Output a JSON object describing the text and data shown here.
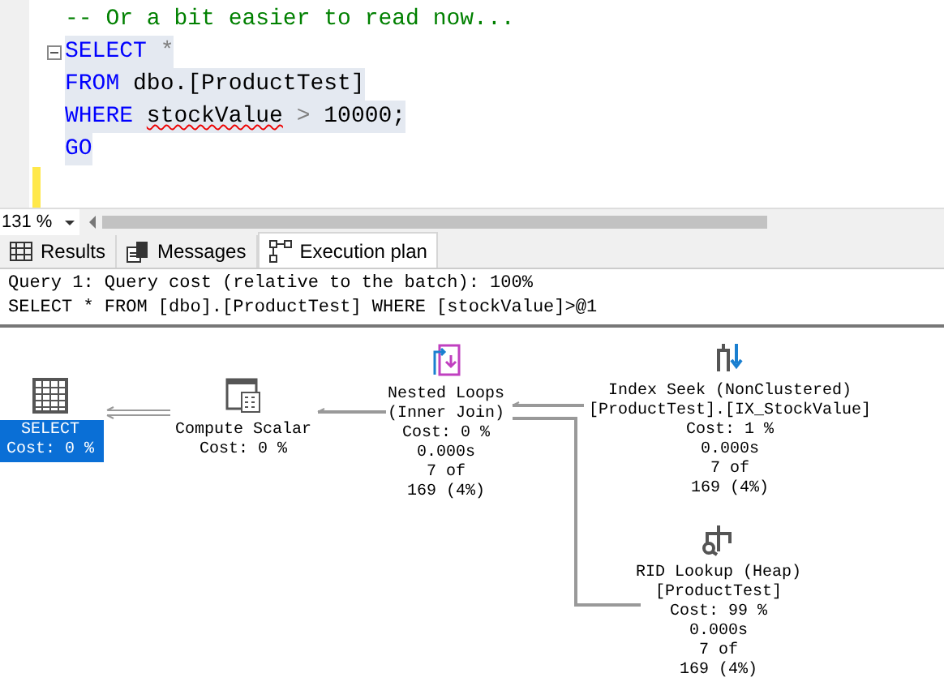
{
  "editor": {
    "lines": [
      {
        "selected": false,
        "fold": false,
        "segments": [
          {
            "text": "-- Or a bit easier to read now...",
            "kind": "comment"
          }
        ]
      },
      {
        "selected": true,
        "fold": true,
        "segments": [
          {
            "text": "SELECT",
            "kind": "keyword"
          },
          {
            "text": " *",
            "kind": "operator"
          }
        ]
      },
      {
        "selected": true,
        "fold": false,
        "segments": [
          {
            "text": "FROM",
            "kind": "keyword"
          },
          {
            "text": " dbo.[ProductTest]",
            "kind": "plain"
          }
        ]
      },
      {
        "selected": true,
        "fold": false,
        "segments": [
          {
            "text": "WHERE ",
            "kind": "keyword"
          },
          {
            "text": "stockValue",
            "kind": "error"
          },
          {
            "text": " >",
            "kind": "operator"
          },
          {
            "text": " 10000;",
            "kind": "plain"
          }
        ]
      },
      {
        "selected": true,
        "fold": false,
        "segments": [
          {
            "text": "GO",
            "kind": "keyword"
          }
        ]
      }
    ]
  },
  "zoom": "131 %",
  "tabs": [
    {
      "label": "Results",
      "selected": false,
      "kind": "grid"
    },
    {
      "label": "Messages",
      "selected": false,
      "kind": "messages"
    },
    {
      "label": "Execution plan",
      "selected": true,
      "kind": "plan"
    }
  ],
  "query": {
    "header": "Query 1: Query cost (relative to the batch): 100%",
    "statement": "SELECT * FROM [dbo].[ProductTest] WHERE [stockValue]>@1"
  },
  "plan_nodes": [
    {
      "kind": "select",
      "selected": true,
      "lines": [
        "SELECT",
        "Cost: 0 %"
      ]
    },
    {
      "kind": "compute",
      "selected": false,
      "lines": [
        "Compute Scalar",
        "Cost: 0 %"
      ]
    },
    {
      "kind": "loops",
      "selected": false,
      "lines": [
        "Nested Loops",
        "(Inner Join)",
        "Cost: 0 %",
        "0.000s",
        "7 of",
        "169 (4%)"
      ]
    },
    {
      "kind": "seek",
      "selected": false,
      "lines": [
        "Index Seek (NonClustered)",
        "[ProductTest].[IX_StockValue]",
        "Cost: 1 %",
        "0.000s",
        "7 of",
        "169 (4%)"
      ]
    },
    {
      "kind": "lookup",
      "selected": false,
      "lines": [
        "RID Lookup (Heap)",
        "[ProductTest]",
        "Cost: 99 %",
        "0.000s",
        "7 of",
        "169 (4%)"
      ]
    }
  ]
}
